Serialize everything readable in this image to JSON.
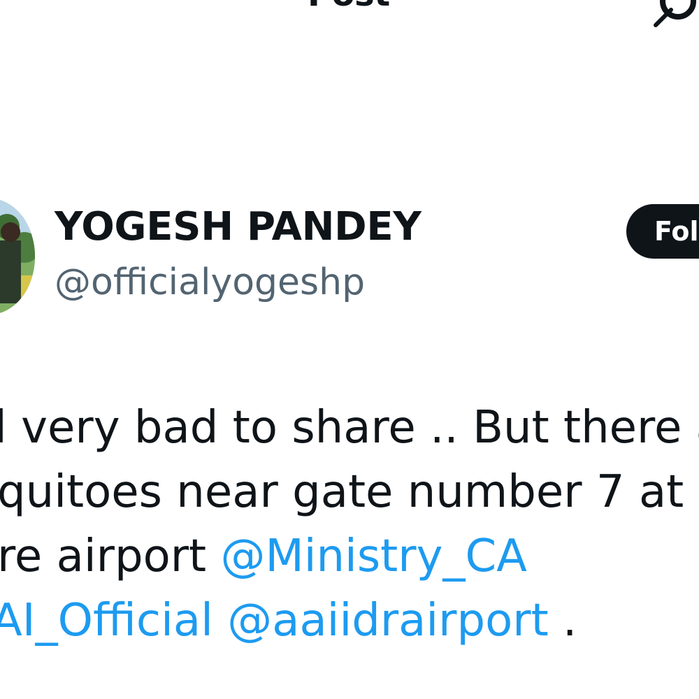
{
  "header": {
    "title": "Post",
    "icon": "grok-icon"
  },
  "author": {
    "avatar": "profile-photo",
    "name": "YOGESH PANDEY",
    "handle": "@officialyogeshp",
    "follow_label": "Foll"
  },
  "tweet": {
    "line1": "l very bad to share .. But there are",
    "line2": "quitoes near gate number 7 at",
    "line3_text": "re airport ",
    "mention1": "@Ministry_CA",
    "mention2": "AI_Official",
    "mention3": "@aaiidrairport",
    "line4_end": " ."
  },
  "colors": {
    "mention": "#1d9bf0",
    "handle": "#536471",
    "text": "#0f1419"
  }
}
